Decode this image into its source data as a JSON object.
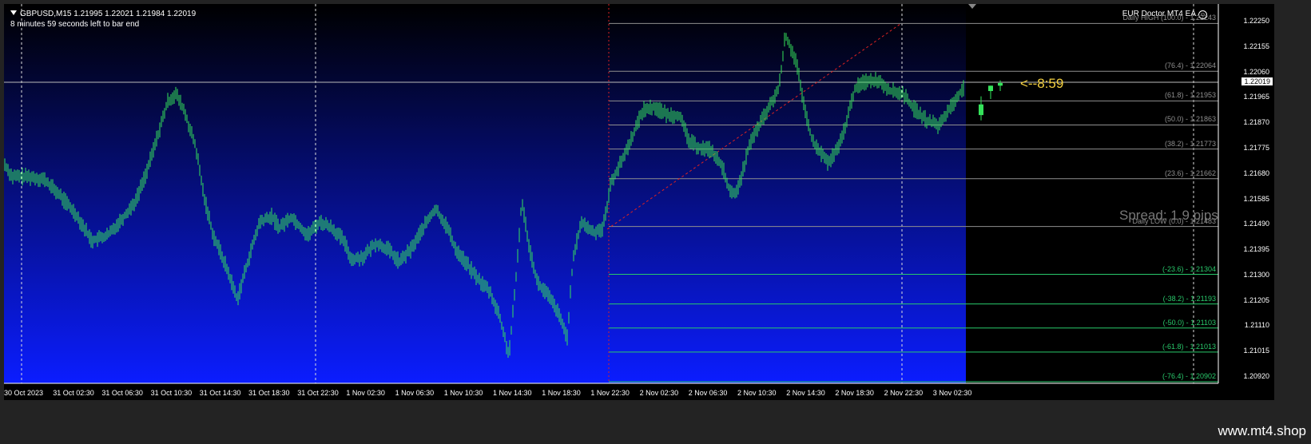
{
  "header": {
    "symbol_line": "GBPUSD,M15  1.21995 1.22021 1.21984 1.22019",
    "timer_line": "8 minutes 59 seconds left to bar end"
  },
  "ea": {
    "label": "EUR Doctor MT4 EA",
    "smiley": "☺"
  },
  "spread_text": "Spread: 1.9 pips",
  "countdown_text": "<--8:59",
  "current_price": "1.22019",
  "price_scale": [
    "1.22250",
    "1.22155",
    "1.22060",
    "1.21965",
    "1.21870",
    "1.21775",
    "1.21680",
    "1.21585",
    "1.21490",
    "1.21395",
    "1.21300",
    "1.21205",
    "1.21110",
    "1.21015",
    "1.20920"
  ],
  "fib_levels": [
    {
      "label": "Daily HIGH (100.0) - 1.22243",
      "color": "#8f8f8f"
    },
    {
      "label": "(76.4) - 1.22064",
      "color": "#8f8f8f"
    },
    {
      "label": "(61.8) - 1.21953",
      "color": "#8f8f8f"
    },
    {
      "label": "(50.0) - 1.21863",
      "color": "#8f8f8f"
    },
    {
      "label": "(38.2) - 1.21773",
      "color": "#8f8f8f"
    },
    {
      "label": "(23.6) - 1.21662",
      "color": "#8f8f8f"
    },
    {
      "label": "Daily LOW (0.0) - 1.21483",
      "color": "#8f8f8f"
    },
    {
      "label": "(-23.6) - 1.21304",
      "color": "#29c96b"
    },
    {
      "label": "(-38.2) - 1.21193",
      "color": "#29c96b"
    },
    {
      "label": "(-50.0) - 1.21103",
      "color": "#29c96b"
    },
    {
      "label": "(-61.8) - 1.21013",
      "color": "#29c96b"
    },
    {
      "label": "(-76.4) - 1.20902",
      "color": "#29c96b"
    }
  ],
  "time_scale": [
    "30 Oct 2023",
    "31 Oct 02:30",
    "31 Oct 06:30",
    "31 Oct 10:30",
    "31 Oct 14:30",
    "31 Oct 18:30",
    "31 Oct 22:30",
    "1 Nov 02:30",
    "1 Nov 06:30",
    "1 Nov 10:30",
    "1 Nov 14:30",
    "1 Nov 18:30",
    "1 Nov 22:30",
    "2 Nov 02:30",
    "2 Nov 06:30",
    "2 Nov 10:30",
    "2 Nov 14:30",
    "2 Nov 18:30",
    "2 Nov 22:30",
    "3 Nov 02:30"
  ],
  "watermark": "www.mt4.shop",
  "colors": {
    "candle": "#35e35a",
    "bg_top": "#000000",
    "bg_bottom": "#0b1dff",
    "fib_up": "#8f8f8f",
    "fib_down": "#29c96b",
    "trend": "#d22"
  }
}
